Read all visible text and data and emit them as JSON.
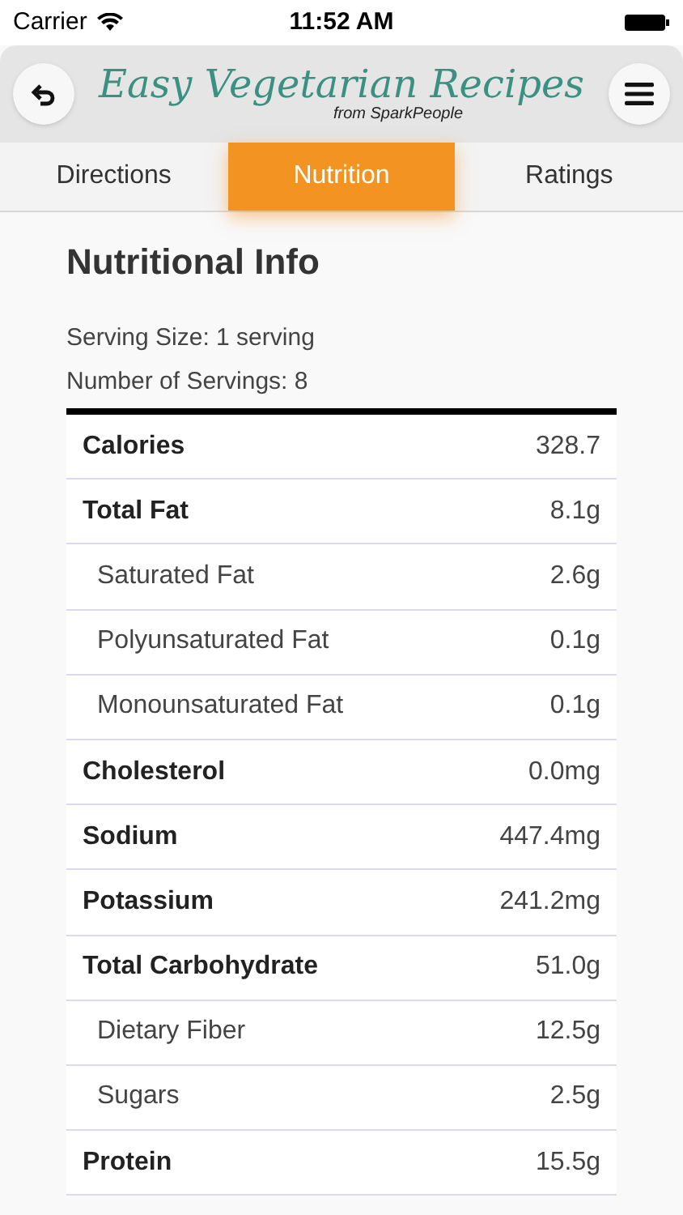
{
  "status_bar": {
    "carrier": "Carrier",
    "time": "11:52 AM"
  },
  "header": {
    "title": "Easy Vegetarian Recipes",
    "subtitle": "from SparkPeople"
  },
  "tabs": [
    {
      "label": "Directions",
      "selected": false
    },
    {
      "label": "Nutrition",
      "selected": true
    },
    {
      "label": "Ratings",
      "selected": false
    }
  ],
  "title": "Nutritional Info",
  "serving_size": "Serving Size: 1 serving",
  "servings": "Number of Servings: 8",
  "rows": [
    {
      "kind": "main",
      "name": "Calories",
      "value": "328.7"
    },
    {
      "kind": "main",
      "name": "Total Fat",
      "value": "8.1g"
    },
    {
      "kind": "sub",
      "name": "Saturated Fat",
      "value": "2.6g"
    },
    {
      "kind": "sub",
      "name": "Polyunsaturated Fat",
      "value": "0.1g"
    },
    {
      "kind": "sub",
      "name": "Monounsaturated Fat",
      "value": "0.1g"
    },
    {
      "kind": "main",
      "name": "Cholesterol",
      "value": "0.0mg"
    },
    {
      "kind": "main",
      "name": "Sodium",
      "value": "447.4mg"
    },
    {
      "kind": "main",
      "name": "Potassium",
      "value": "241.2mg"
    },
    {
      "kind": "main",
      "name": "Total Carbohydrate",
      "value": "51.0g"
    },
    {
      "kind": "sub",
      "name": "Dietary Fiber",
      "value": "12.5g"
    },
    {
      "kind": "sub",
      "name": "Sugars",
      "value": "2.5g"
    },
    {
      "kind": "main",
      "name": "Protein",
      "value": "15.5g"
    }
  ]
}
